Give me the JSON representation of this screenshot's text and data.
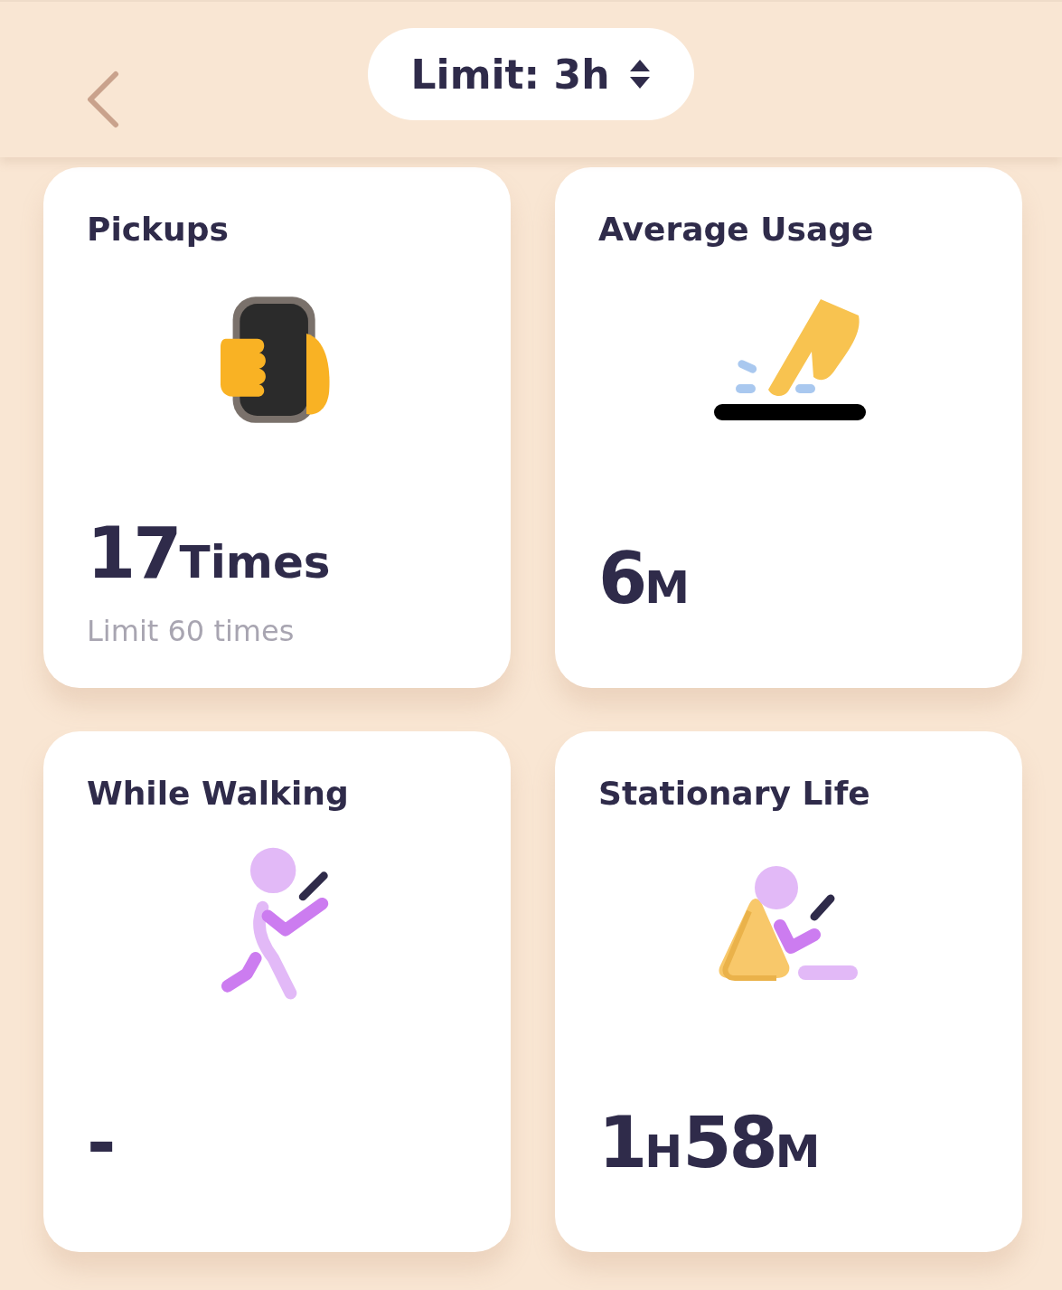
{
  "header": {
    "limit_label": "Limit: 3h"
  },
  "cards": [
    {
      "title": "Pickups",
      "kind": "phone-hand",
      "value": [
        {
          "text": "17",
          "kind": "number"
        },
        {
          "text": "Times",
          "kind": "unit"
        }
      ],
      "sub": "Limit 60 times"
    },
    {
      "title": "Average Usage",
      "kind": "tap",
      "value": [
        {
          "text": "6",
          "kind": "number"
        },
        {
          "text": "M",
          "kind": "unit"
        }
      ]
    },
    {
      "title": "While Walking",
      "kind": "walking",
      "value": [
        {
          "text": "-",
          "kind": "number"
        }
      ]
    },
    {
      "title": "Stationary Life",
      "kind": "sitting",
      "value": [
        {
          "text": "1",
          "kind": "number"
        },
        {
          "text": "H",
          "kind": "unit"
        },
        {
          "text": "58",
          "kind": "number"
        },
        {
          "text": "M",
          "kind": "unit"
        }
      ]
    }
  ]
}
